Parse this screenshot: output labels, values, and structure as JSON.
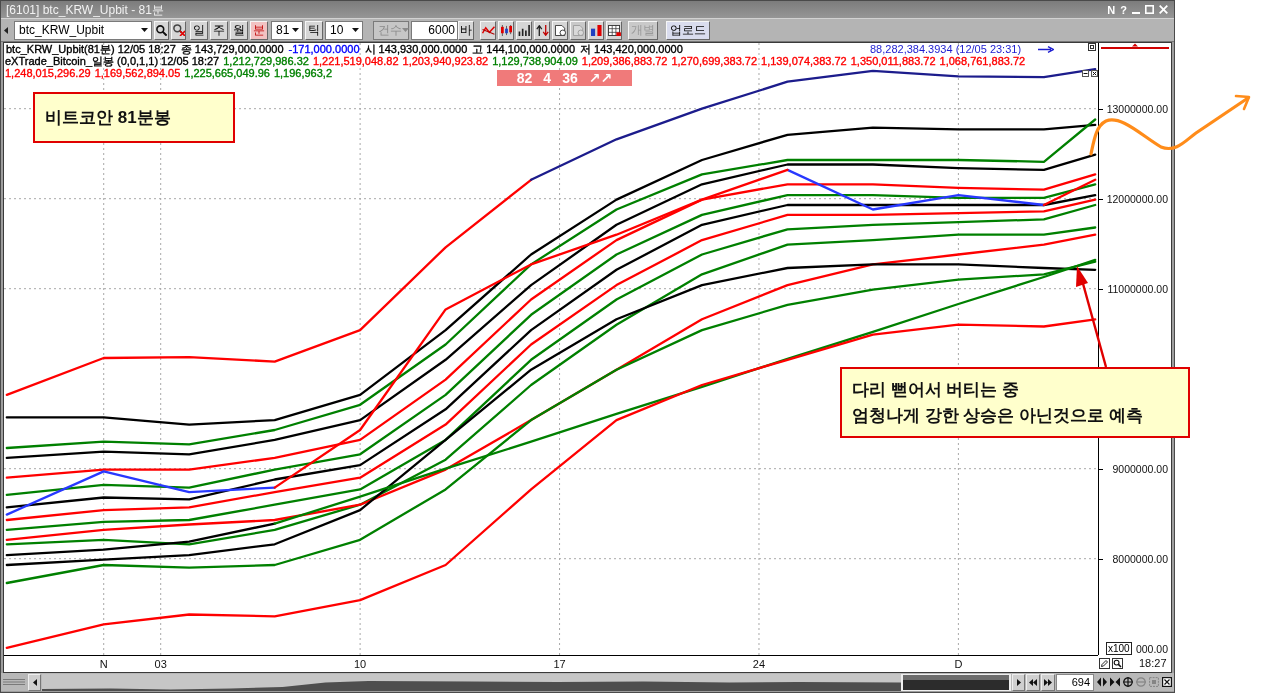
{
  "window": {
    "title": "[6101] btc_KRW_Upbit - 81분",
    "title_buttons": [
      "N",
      "?"
    ]
  },
  "toolbar": {
    "symbol": "btc_KRW_Upbit",
    "periods": [
      {
        "label": "일",
        "selected": false
      },
      {
        "label": "주",
        "selected": false
      },
      {
        "label": "월",
        "selected": false
      },
      {
        "label": "분",
        "selected": true
      }
    ],
    "interval": "81",
    "tick_button": "틱",
    "tick_count": "10",
    "count_mode": {
      "label": "건수",
      "disabled": true
    },
    "bar_count": "6000",
    "bar_unit": "바",
    "icon_buttons": [
      {
        "kind": "signal",
        "disabled": false
      },
      {
        "kind": "candles",
        "disabled": false
      },
      {
        "kind": "bars",
        "disabled": false
      },
      {
        "kind": "updown",
        "disabled": false
      },
      {
        "kind": "document",
        "disabled": false
      },
      {
        "kind": "document",
        "disabled": true
      },
      {
        "kind": "compare",
        "disabled": false
      },
      {
        "kind": "table",
        "disabled": false
      }
    ],
    "split_button": {
      "label": "개별",
      "disabled": true
    },
    "upload_button": "업로드"
  },
  "chart": {
    "price_info": [
      {
        "text": "btc_KRW_Upbit(81분) 12/05 18:27",
        "color": "#000000"
      },
      {
        "text": "종 143,729,000.0000",
        "color": "#000000"
      },
      {
        "text": "-171,000.0000",
        "color": "#0000ff"
      },
      {
        "text": "시 143,930,000.0000",
        "color": "#000000"
      },
      {
        "text": "고 144,100,000.0000",
        "color": "#000000"
      },
      {
        "text": "저 143,420,000.0000",
        "color": "#000000"
      }
    ],
    "price_extra": "88,282,384.3934 (12/05 23:31)",
    "indicator_name": "eXTrade_Bitcoin_일봉 (0,0,1,1) 12/05 18:27",
    "indicator_values": [
      {
        "text": "1,212,729,986.32",
        "color": "#008000"
      },
      {
        "text": "1,221,519,048.82",
        "color": "#ff0000"
      },
      {
        "text": "1,203,940,923.82",
        "color": "#ff0000"
      },
      {
        "text": "1,129,738,904.09",
        "color": "#008000"
      },
      {
        "text": "1,209,386,883.72",
        "color": "#ff0000"
      },
      {
        "text": "1,270,699,383.72",
        "color": "#ff0000"
      },
      {
        "text": "1,139,074,383.72",
        "color": "#ff0000"
      },
      {
        "text": "1,350,011,883.72",
        "color": "#ff0000"
      },
      {
        "text": "1,068,761,883.72",
        "color": "#ff0000"
      },
      {
        "text": "1,248,015,296.29",
        "color": "#ff0000"
      },
      {
        "text": "1,169,562,894.05",
        "color": "#ff0000"
      },
      {
        "text": "1,225,665,049.96",
        "color": "#008000"
      },
      {
        "text": "1,196,963,2",
        "color": "#008000"
      }
    ],
    "badge": [
      "82",
      "4",
      "36",
      "↗↗"
    ],
    "chart_data": {
      "type": "line",
      "grid": true,
      "x": [
        -2.4,
        1,
        4,
        7,
        10,
        13,
        16,
        19,
        22,
        25,
        28,
        31,
        34,
        35.8
      ],
      "xlim": [
        -2.5,
        35.9
      ],
      "ylim": [
        6930000,
        13730000
      ],
      "xticks": [
        {
          "value": 1,
          "label": "N"
        },
        {
          "value": 3,
          "label": "03"
        },
        {
          "value": 10,
          "label": "10"
        },
        {
          "value": 17,
          "label": "17"
        },
        {
          "value": 24,
          "label": "24"
        },
        {
          "value": 31,
          "label": "D"
        }
      ],
      "yticks": [
        {
          "value": 13000000,
          "label": "13000000.00"
        },
        {
          "value": 12000000,
          "label": "12000000.00"
        },
        {
          "value": 11000000,
          "label": "11000000.00"
        },
        {
          "value": 9000000,
          "label": "9000000.00"
        },
        {
          "value": 8000000,
          "label": "8000000.00"
        }
      ],
      "series": [
        {
          "color": "#ff0000",
          "values": [
            9820000,
            10230000,
            10240000,
            10190000,
            10540000,
            11460000,
            12210000,
            null,
            null,
            null,
            null,
            null,
            null,
            null
          ]
        },
        {
          "color": "#1c1c8c",
          "values": [
            null,
            null,
            null,
            null,
            null,
            null,
            12210000,
            12660000,
            13000000,
            13300000,
            13420000,
            13360000,
            13350000,
            13440000
          ]
        },
        {
          "color": "#000000",
          "values": [
            9570000,
            9570000,
            9490000,
            9540000,
            9820000,
            10540000,
            11380000,
            11990000,
            12430000,
            12710000,
            12790000,
            12770000,
            12770000,
            12820000
          ]
        },
        {
          "color": "#008000",
          "values": [
            9230000,
            9300000,
            9270000,
            9430000,
            9710000,
            10380000,
            11270000,
            11880000,
            12270000,
            12430000,
            12430000,
            12430000,
            12410000,
            12880000
          ]
        },
        {
          "color": "#000000",
          "values": [
            9120000,
            9190000,
            9160000,
            9320000,
            9540000,
            10210000,
            11040000,
            11710000,
            12160000,
            12380000,
            12380000,
            12340000,
            12320000,
            12490000
          ]
        },
        {
          "color": "#ff0000",
          "values": [
            8900000,
            8990000,
            8990000,
            9120000,
            9320000,
            9990000,
            10880000,
            11540000,
            11990000,
            12160000,
            12160000,
            12120000,
            12100000,
            12270000
          ]
        },
        {
          "color": "#008000",
          "values": [
            8710000,
            8820000,
            8790000,
            8990000,
            9160000,
            9820000,
            10710000,
            11380000,
            11820000,
            12040000,
            12040000,
            12010000,
            12010000,
            12160000
          ]
        },
        {
          "color": "#000000",
          "values": [
            8570000,
            8680000,
            8660000,
            8880000,
            9040000,
            9660000,
            10540000,
            11210000,
            11710000,
            11930000,
            11930000,
            11930000,
            11930000,
            12040000
          ]
        },
        {
          "color": "#ff0000",
          "values": [
            8430000,
            8540000,
            8570000,
            8740000,
            8900000,
            9490000,
            10380000,
            11040000,
            11540000,
            11820000,
            11820000,
            11840000,
            11860000,
            11990000
          ]
        },
        {
          "color": "#008000",
          "values": [
            8320000,
            8410000,
            8430000,
            8600000,
            8770000,
            9320000,
            10210000,
            10880000,
            11380000,
            11660000,
            11710000,
            11740000,
            11770000,
            11930000
          ]
        },
        {
          "color": "#008000",
          "values": [
            8160000,
            8210000,
            8160000,
            8320000,
            8600000,
            9100000,
            9930000,
            10600000,
            11160000,
            11490000,
            11540000,
            11600000,
            11600000,
            11680000
          ]
        },
        {
          "color": "#ff0000",
          "values": [
            8210000,
            8320000,
            8380000,
            8430000,
            8600000,
            8990000,
            9540000,
            10100000,
            10660000,
            11040000,
            11270000,
            11380000,
            11490000,
            11600000
          ]
        },
        {
          "color": "#000000",
          "values": [
            7930000,
            7990000,
            8040000,
            8160000,
            8540000,
            9320000,
            10100000,
            10660000,
            11040000,
            11230000,
            11270000,
            11270000,
            11230000,
            11210000
          ]
        },
        {
          "color": "#008000",
          "values": [
            7730000,
            7930000,
            7900000,
            7930000,
            8210000,
            8770000,
            9540000,
            10100000,
            10540000,
            10820000,
            10990000,
            11100000,
            11160000,
            11300000
          ]
        },
        {
          "color": "#000000",
          "values": [
            8040000,
            8100000,
            8190000,
            8390000,
            null,
            null,
            null,
            null,
            null,
            null,
            null,
            null,
            null,
            null
          ]
        },
        {
          "color": "#008000",
          "values": [
            null,
            null,
            null,
            8390000,
            8690000,
            9000000,
            9300000,
            9610000,
            9910000,
            10220000,
            10520000,
            10830000,
            11130000,
            11320000
          ]
        },
        {
          "color": "#ff0000",
          "values": [
            7010000,
            7270000,
            7380000,
            7360000,
            7540000,
            7930000,
            8770000,
            9540000,
            9930000,
            10210000,
            10490000,
            10600000,
            10580000,
            10660000
          ]
        },
        {
          "color": "#2838ff",
          "values": [
            8490000,
            8970000,
            8740000,
            8790000,
            null,
            null,
            null,
            null,
            null,
            12320000,
            11880000,
            12040000,
            11930000,
            null
          ]
        },
        {
          "color": "#ff0000",
          "values": [
            null,
            null,
            null,
            8790000,
            9430000,
            10770000,
            11270000,
            11600000,
            11990000,
            12320000,
            null,
            null,
            11930000,
            12210000
          ]
        }
      ]
    },
    "axis_cut_label": "000.00",
    "scale_badge": "x100",
    "cursor_time": "18:27",
    "notes": [
      {
        "lines": [
          "비트코안 81분봉"
        ]
      },
      {
        "lines": [
          "다리 뻗어서 버티는 중",
          "엄청나게 강한 상승은 아닌것으로 예측"
        ]
      }
    ]
  },
  "scrollbar": {
    "visible_bars": "694",
    "tools": [
      {
        "kind": "fit",
        "disabled": false
      },
      {
        "kind": "collapse",
        "disabled": false
      },
      {
        "kind": "zoom-in",
        "disabled": false
      },
      {
        "kind": "zoom-out",
        "disabled": true
      },
      {
        "kind": "full",
        "disabled": true
      },
      {
        "kind": "reset",
        "disabled": false
      }
    ]
  }
}
